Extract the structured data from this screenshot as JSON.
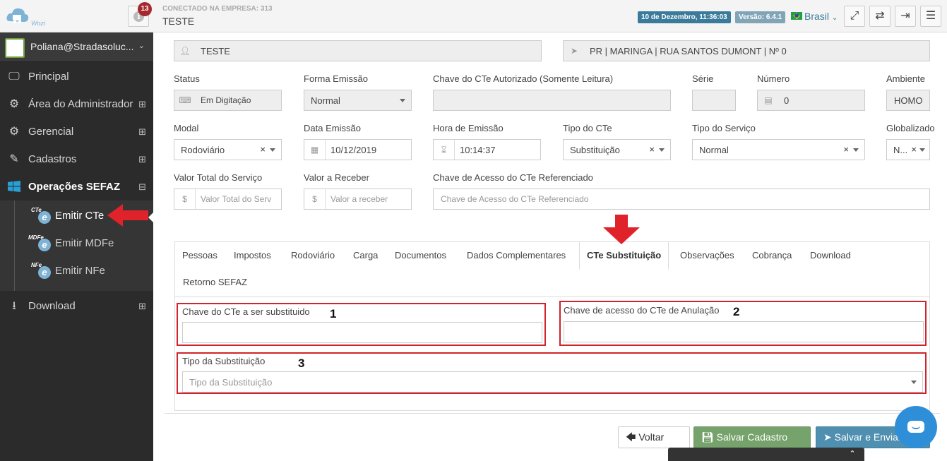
{
  "topbar": {
    "logo_text": "Wozi",
    "notification_count": "13",
    "company_label": "CONECTADO NA EMPRESA: 313",
    "company_name": "TESTE",
    "datetime": "10 de Dezembro, 11:36:03",
    "version": "Versão: 6.4.1",
    "language": "Brasil"
  },
  "sidebar": {
    "user": "Poliana@Stradasoluc...",
    "items": [
      {
        "label": "Principal",
        "icon": "monitor-icon"
      },
      {
        "label": "Área do Administrador",
        "icon": "gears-icon"
      },
      {
        "label": "Gerencial",
        "icon": "gears-icon"
      },
      {
        "label": "Cadastros",
        "icon": "edit-icon"
      },
      {
        "label": "Operações SEFAZ",
        "icon": "windows-icon"
      },
      {
        "label": "Download",
        "icon": "download-icon"
      }
    ],
    "sub_items": [
      {
        "label": "Emitir CTe",
        "tag": "CTe"
      },
      {
        "label": "Emitir MDFe",
        "tag": "MDFe"
      },
      {
        "label": "Emitir NFe",
        "tag": "NFe"
      }
    ]
  },
  "form": {
    "top_left_value": "TESTE",
    "top_right_value": "PR | MARINGA | RUA SANTOS DUMONT | Nº 0",
    "status_label": "Status",
    "status_value": "Em Digitação",
    "forma_label": "Forma Emissão",
    "forma_value": "Normal",
    "chave_aut_label": "Chave do CTe Autorizado (Somente Leitura)",
    "serie_label": "Série",
    "numero_label": "Número",
    "numero_value": "0",
    "ambiente_label": "Ambiente",
    "ambiente_value": "HOMO",
    "modal_label": "Modal",
    "modal_value": "Rodoviário",
    "data_label": "Data Emissão",
    "data_value": "10/12/2019",
    "hora_label": "Hora de Emissão",
    "hora_value": "10:14:37",
    "tipo_cte_label": "Tipo do CTe",
    "tipo_cte_value": "Substituição",
    "tipo_servico_label": "Tipo do Serviço",
    "tipo_servico_value": "Normal",
    "globalizado_label": "Globalizado",
    "globalizado_value": "N...",
    "valor_total_label": "Valor Total do Serviço",
    "valor_total_placeholder": "Valor Total do Serv",
    "valor_receber_label": "Valor a Receber",
    "valor_receber_placeholder": "Valor a receber",
    "chave_ref_label": "Chave de Acesso do CTe Referenciado",
    "chave_ref_placeholder": "Chave de Acesso do CTe Referenciado"
  },
  "tabs": [
    "Pessoas",
    "Impostos",
    "Rodoviário",
    "Carga",
    "Documentos",
    "Dados Complementares",
    "CTe Substituição",
    "Observações",
    "Cobrança",
    "Download",
    "Retorno SEFAZ"
  ],
  "substituicao": {
    "chave_sub_label": "Chave do CTe a ser substituido",
    "chave_anul_label": "Chave de acesso do CTe de Anulação",
    "tipo_sub_label": "Tipo da Substituição",
    "tipo_sub_placeholder": "Tipo da Substituição",
    "marker_1": "1",
    "marker_2": "2",
    "marker_3": "3"
  },
  "buttons": {
    "voltar": "Voltar",
    "salvar": "Salvar Cadastro",
    "enviar": "Salvar e Enviar"
  },
  "colors": {
    "sidebar_bg": "#2b2b2b",
    "accent_blue": "#3a7a9b",
    "save_green": "#76a26b",
    "annotation_red": "#d0232b"
  }
}
